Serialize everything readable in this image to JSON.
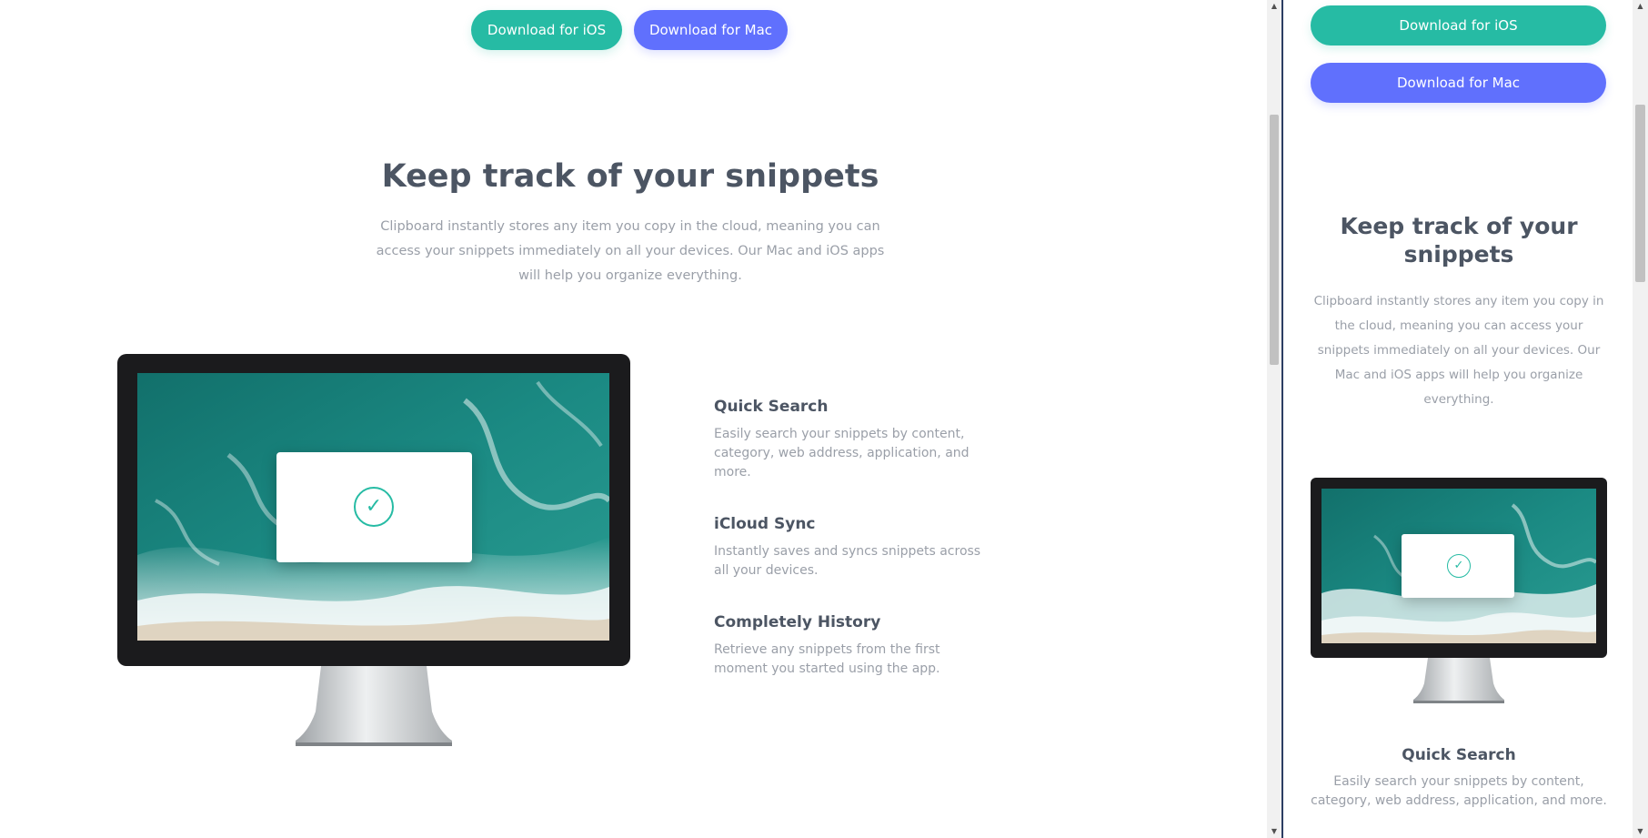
{
  "buttons": {
    "ios_label": "Download for iOS",
    "mac_label": "Download for Mac"
  },
  "snippets": {
    "title": "Keep track of your snippets",
    "description": "Clipboard instantly stores any item you copy in the cloud, meaning you can access your snippets immediately on all your devices. Our Mac and iOS apps will help you organize everything."
  },
  "features": [
    {
      "title": "Quick Search",
      "description": "Easily search your snippets by content, category, web address, application, and more."
    },
    {
      "title": "iCloud Sync",
      "description": "Instantly saves and syncs snippets across all your devices."
    },
    {
      "title": "Completely History",
      "description": "Retrieve any snippets from the first moment you started using the app."
    }
  ],
  "colors": {
    "accent_green": "#26bba4",
    "accent_blue": "#6070fd",
    "heading": "#4c5563",
    "text_muted": "#9a9fa8"
  },
  "icons": {
    "check": "✓",
    "apple": "",
    "arrow_up": "▲",
    "arrow_down": "▼"
  }
}
